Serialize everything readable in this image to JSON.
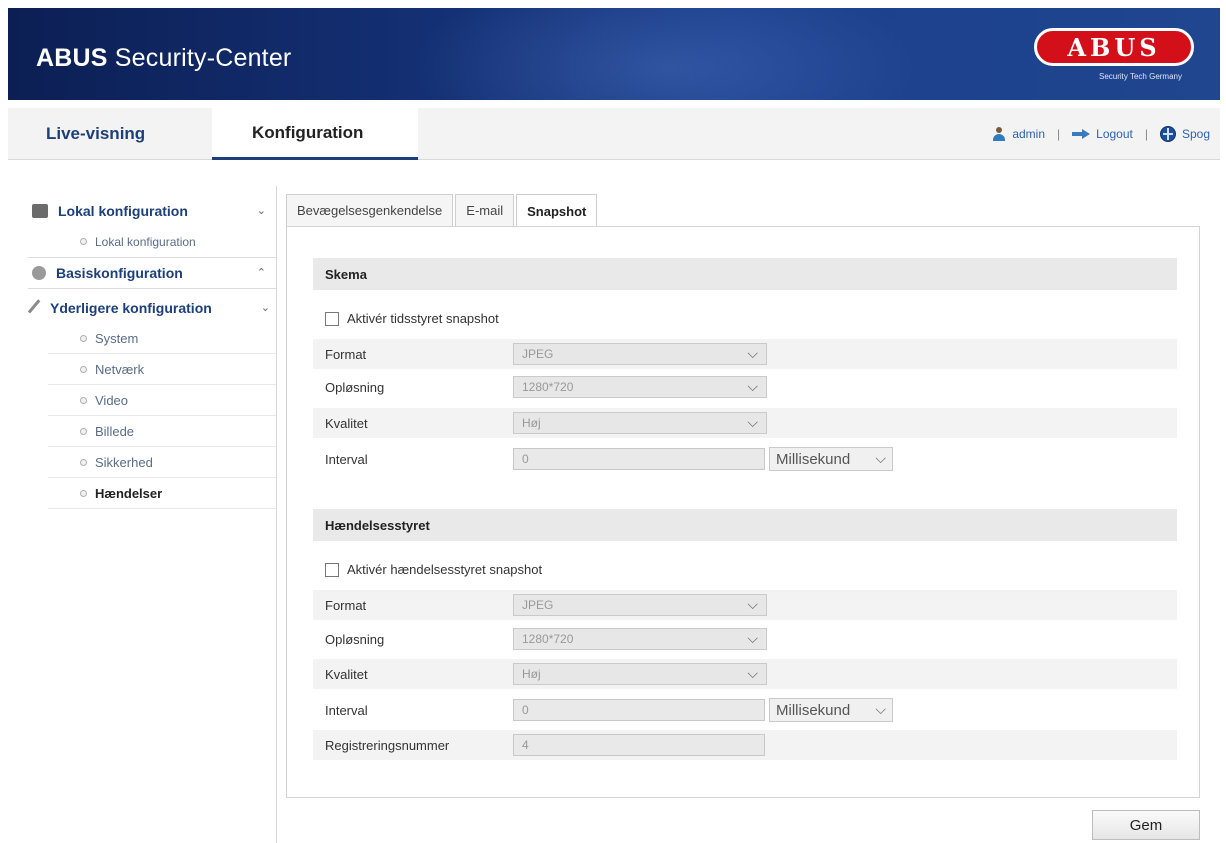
{
  "header": {
    "title_bold": "ABUS",
    "title_rest": " Security-Center",
    "logo_text": "ABUS",
    "logo_tagline": "Security Tech Germany"
  },
  "nav": {
    "tabs": [
      {
        "label": "Live-visning",
        "active": false
      },
      {
        "label": "Konfiguration",
        "active": true
      }
    ],
    "user": "admin",
    "logout": "Logout",
    "language": "Spog",
    "separator": "|"
  },
  "sidebar": {
    "sections": [
      {
        "label": "Lokal konfiguration",
        "chevron": "⌄",
        "items": [
          "Lokal konfiguration"
        ]
      },
      {
        "label": "Basiskonfiguration",
        "chevron": "⌃"
      },
      {
        "label": "Yderligere konfiguration",
        "chevron": "⌄",
        "items": [
          "System",
          "Netværk",
          "Video",
          "Billede",
          "Sikkerhed",
          "Hændelser"
        ],
        "active_item": "Hændelser"
      }
    ]
  },
  "content": {
    "tabs": [
      "Bevægelsesgenkendelse",
      "E-mail",
      "Snapshot"
    ],
    "active_tab": "Snapshot",
    "schedule": {
      "title": "Skema",
      "enable_label": "Aktivér tidsstyret snapshot",
      "enabled": false,
      "format_label": "Format",
      "format_value": "JPEG",
      "resolution_label": "Opløsning",
      "resolution_value": "1280*720",
      "quality_label": "Kvalitet",
      "quality_value": "Høj",
      "interval_label": "Interval",
      "interval_value": "0",
      "interval_unit": "Millisekund"
    },
    "event": {
      "title": "Hændelsesstyret",
      "enable_label": "Aktivér hændelsesstyret snapshot",
      "enabled": false,
      "format_label": "Format",
      "format_value": "JPEG",
      "resolution_label": "Opløsning",
      "resolution_value": "1280*720",
      "quality_label": "Kvalitet",
      "quality_value": "Høj",
      "interval_label": "Interval",
      "interval_value": "0",
      "interval_unit": "Millisekund",
      "capture_number_label": "Registreringsnummer",
      "capture_number_value": "4"
    },
    "dropdown_glyph": "⌵",
    "save_label": "Gem"
  },
  "colors": {
    "header_dark": "#0c1f54",
    "header_light": "#20468f",
    "nav_blue": "#1c3f7a",
    "link_blue": "#2d62b3",
    "logo_red": "#d3101a"
  },
  "icons": [
    "user-icon",
    "logout-icon",
    "globe-icon",
    "camera-icon",
    "gear-icon",
    "wrench-icon",
    "dropdown-arrow-icon"
  ]
}
